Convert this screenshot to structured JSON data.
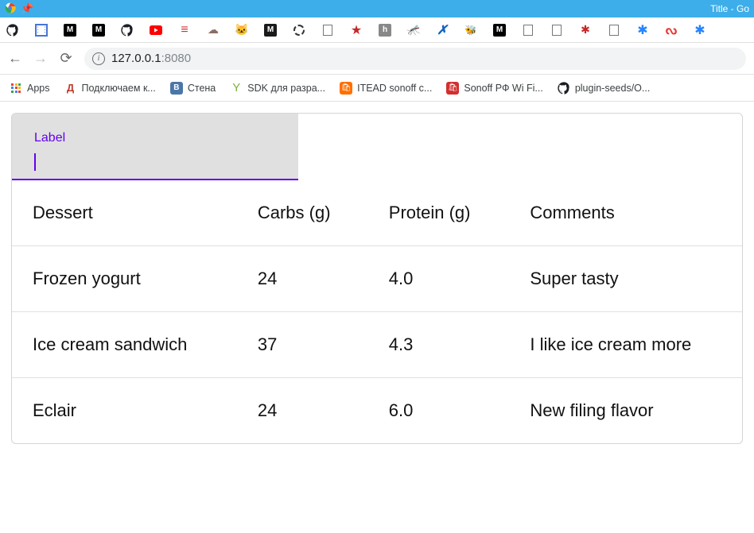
{
  "window": {
    "title": "Title - Go"
  },
  "address_bar": {
    "host": "127.0.0.1",
    "port": ":8080"
  },
  "bookmarks": {
    "apps": "Apps",
    "items": [
      {
        "label": "Подключаем к..."
      },
      {
        "label": "Стена"
      },
      {
        "label": "SDK для разра..."
      },
      {
        "label": "ITEAD sonoff c..."
      },
      {
        "label": "Sonoff РФ Wi Fi..."
      },
      {
        "label": "plugin-seeds/O..."
      }
    ]
  },
  "page": {
    "input": {
      "label": "Label",
      "value": ""
    },
    "table": {
      "headers": [
        "Dessert",
        "Carbs (g)",
        "Protein (g)",
        "Comments"
      ],
      "rows": [
        {
          "cells": [
            "Frozen yogurt",
            "24",
            "4.0",
            "Super tasty"
          ]
        },
        {
          "cells": [
            "Ice cream sandwich",
            "37",
            "4.3",
            "I like ice cream more"
          ]
        },
        {
          "cells": [
            "Eclair",
            "24",
            "6.0",
            "New filing flavor"
          ]
        }
      ]
    }
  }
}
